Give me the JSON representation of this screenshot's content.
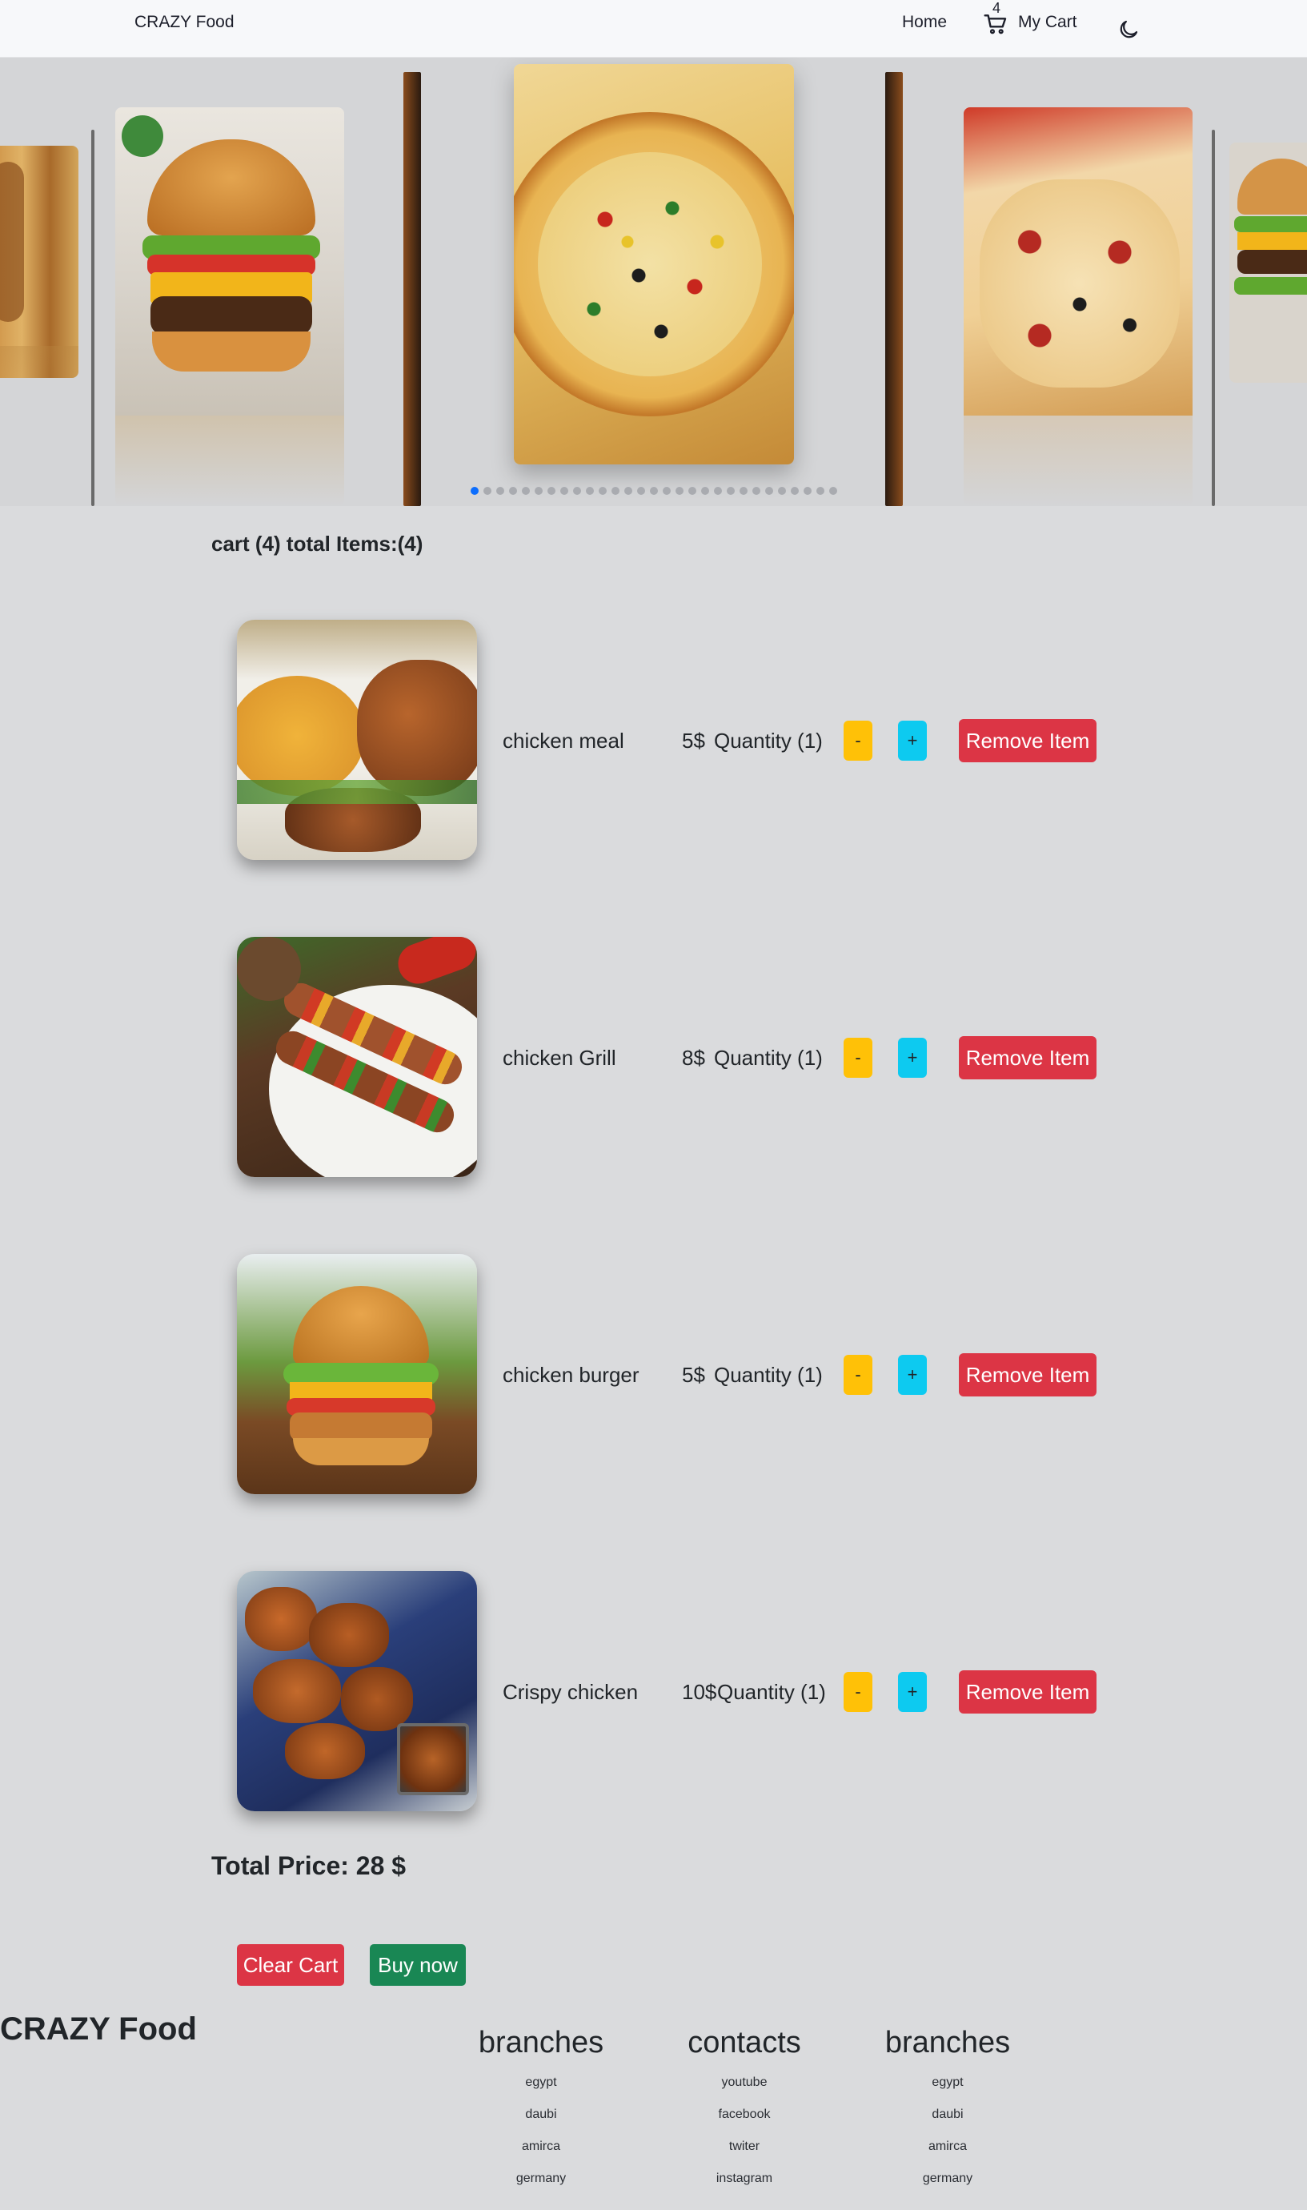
{
  "navbar": {
    "brand": "CRAZY Food",
    "home_label": "Home",
    "cart_count": "4",
    "cart_label": "My Cart"
  },
  "carousel": {
    "slide_count": 29,
    "active_index": 0
  },
  "cart": {
    "title": "cart (4) total Items:(4)",
    "items": [
      {
        "name": "chicken meal",
        "price": "5$",
        "quantity": "Quantity (1)",
        "minus": "-",
        "plus": "+",
        "remove": "Remove Item"
      },
      {
        "name": "chicken Grill",
        "price": "8$",
        "quantity": "Quantity (1)",
        "minus": "-",
        "plus": "+",
        "remove": "Remove Item"
      },
      {
        "name": "chicken burger",
        "price": "5$",
        "quantity": "Quantity (1)",
        "minus": "-",
        "plus": "+",
        "remove": "Remove Item"
      },
      {
        "name": "Crispy chicken",
        "price": "10$",
        "quantity": "Quantity (1)",
        "minus": "-",
        "plus": "+",
        "remove": "Remove Item"
      }
    ],
    "total_price": "Total Price: 28 $",
    "clear_label": "Clear Cart",
    "buy_label": "Buy now"
  },
  "footer": {
    "brand": "CRAZY Food",
    "columns": [
      {
        "title": "branches",
        "links": [
          "egypt",
          "daubi",
          "amirca",
          "germany"
        ]
      },
      {
        "title": "contacts",
        "links": [
          "youtube",
          "facebook",
          "twiter",
          "instagram"
        ]
      },
      {
        "title": "branches",
        "links": [
          "egypt",
          "daubi",
          "amirca",
          "germany"
        ]
      }
    ]
  },
  "colors": {
    "page_bg": "#dadbdd",
    "warning": "#ffc107",
    "info": "#0dcaf0",
    "danger": "#dc3545",
    "success": "#198754",
    "active_dot": "#0d6efd"
  },
  "icons": [
    "cart-icon",
    "moon-icon"
  ]
}
